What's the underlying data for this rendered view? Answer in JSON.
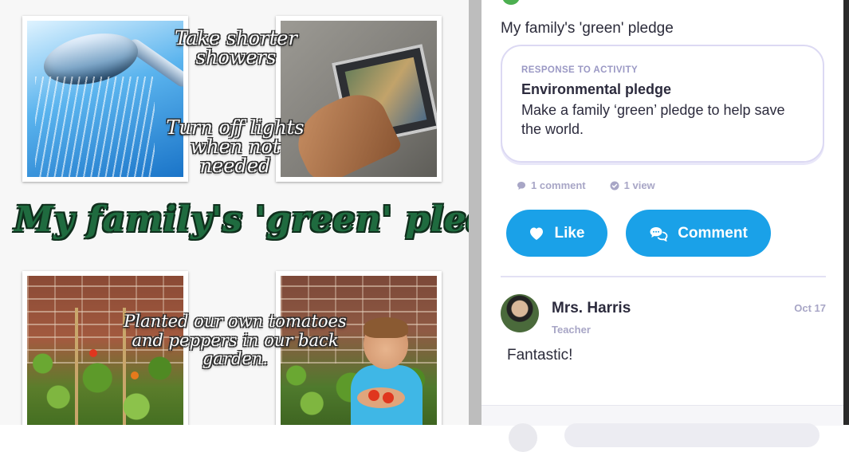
{
  "poster": {
    "caption_showers": "Take shorter showers",
    "caption_lights": "Turn off lights when not needed",
    "title": "My family's 'green' pledge",
    "caption_garden": "Planted our own tomatoes and peppers in our back garden."
  },
  "post": {
    "caption": "My family's 'green' pledge",
    "activity": {
      "label": "RESPONSE TO ACTIVITY",
      "title": "Environmental pledge",
      "description": "Make a family ‘green’ pledge to help save the world."
    },
    "stats": {
      "comments": "1 comment",
      "views": "1 view"
    },
    "actions": {
      "like_label": "Like",
      "comment_label": "Comment"
    },
    "colors": {
      "accent": "#1aa1e8",
      "muted": "#a8a6c6",
      "card_border": "#dcd9f3"
    }
  },
  "comment": {
    "author": "Mrs. Harris",
    "role": "Teacher",
    "date": "Oct 17",
    "text": "Fantastic!"
  }
}
